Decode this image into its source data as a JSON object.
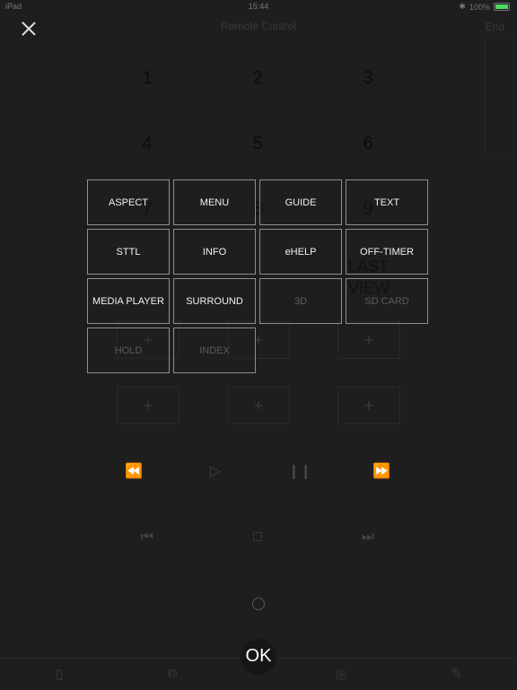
{
  "status": {
    "device": "iPad",
    "time": "15:44",
    "battery": "100%"
  },
  "header": {
    "title": "Remote Control",
    "end_label": "End"
  },
  "keypad": {
    "numbers": [
      "1",
      "2",
      "3",
      "4",
      "5",
      "6",
      "7",
      "8",
      "9"
    ],
    "last_view": "LAST VIEW",
    "plus": "+"
  },
  "overlay": {
    "buttons": [
      {
        "label": "ASPECT",
        "enabled": true
      },
      {
        "label": "MENU",
        "enabled": true
      },
      {
        "label": "GUIDE",
        "enabled": true
      },
      {
        "label": "TEXT",
        "enabled": true
      },
      {
        "label": "STTL",
        "enabled": true
      },
      {
        "label": "INFO",
        "enabled": true
      },
      {
        "label": "eHELP",
        "enabled": true
      },
      {
        "label": "OFF-TIMER",
        "enabled": true
      },
      {
        "label": "MEDIA PLAYER",
        "enabled": true
      },
      {
        "label": "SURROUND",
        "enabled": true
      },
      {
        "label": "3D",
        "enabled": false
      },
      {
        "label": "SD CARD",
        "enabled": false
      },
      {
        "label": "HOLD",
        "enabled": false
      },
      {
        "label": "INDEX",
        "enabled": false
      }
    ]
  },
  "transport": {
    "rewind": "⏪",
    "play": "▷",
    "pause": "❙❙",
    "fast_forward": "⏩",
    "skip_back": "⏮",
    "stop": "□",
    "skip_forward": "⏭"
  },
  "ok_label": "OK",
  "colors": {
    "battery": "#4cd964",
    "background": "#1e1e1e",
    "button_border": "#8e8e8e"
  }
}
